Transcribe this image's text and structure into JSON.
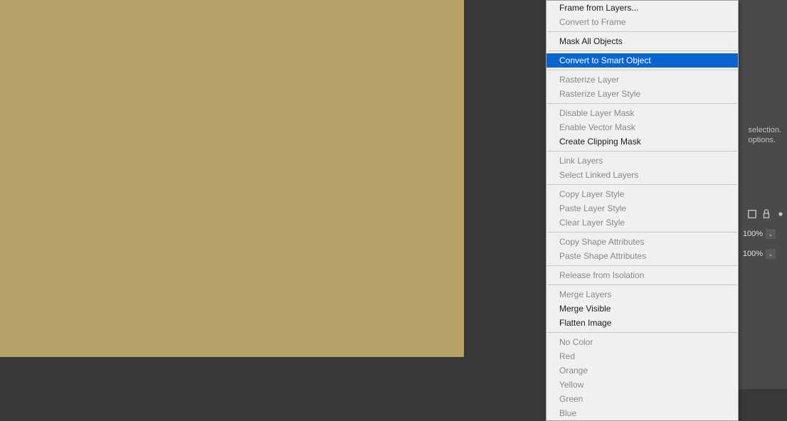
{
  "menu": {
    "items": [
      {
        "label": "Frame from Layers...",
        "disabled": false,
        "highlighted": false
      },
      {
        "label": "Convert to Frame",
        "disabled": true,
        "highlighted": false
      },
      {
        "separator": true
      },
      {
        "label": "Mask All Objects",
        "disabled": false,
        "highlighted": false
      },
      {
        "separator": true
      },
      {
        "label": "Convert to Smart Object",
        "disabled": false,
        "highlighted": true
      },
      {
        "separator": true
      },
      {
        "label": "Rasterize Layer",
        "disabled": true,
        "highlighted": false
      },
      {
        "label": "Rasterize Layer Style",
        "disabled": true,
        "highlighted": false
      },
      {
        "separator": true
      },
      {
        "label": "Disable Layer Mask",
        "disabled": true,
        "highlighted": false
      },
      {
        "label": "Enable Vector Mask",
        "disabled": true,
        "highlighted": false
      },
      {
        "label": "Create Clipping Mask",
        "disabled": false,
        "highlighted": false
      },
      {
        "separator": true
      },
      {
        "label": "Link Layers",
        "disabled": true,
        "highlighted": false
      },
      {
        "label": "Select Linked Layers",
        "disabled": true,
        "highlighted": false
      },
      {
        "separator": true
      },
      {
        "label": "Copy Layer Style",
        "disabled": true,
        "highlighted": false
      },
      {
        "label": "Paste Layer Style",
        "disabled": true,
        "highlighted": false
      },
      {
        "label": "Clear Layer Style",
        "disabled": true,
        "highlighted": false
      },
      {
        "separator": true
      },
      {
        "label": "Copy Shape Attributes",
        "disabled": true,
        "highlighted": false
      },
      {
        "label": "Paste Shape Attributes",
        "disabled": true,
        "highlighted": false
      },
      {
        "separator": true
      },
      {
        "label": "Release from Isolation",
        "disabled": true,
        "highlighted": false
      },
      {
        "separator": true
      },
      {
        "label": "Merge Layers",
        "disabled": true,
        "highlighted": false
      },
      {
        "label": "Merge Visible",
        "disabled": false,
        "highlighted": false
      },
      {
        "label": "Flatten Image",
        "disabled": false,
        "highlighted": false
      },
      {
        "separator": true
      },
      {
        "label": "No Color",
        "disabled": true,
        "highlighted": false
      },
      {
        "label": "Red",
        "disabled": true,
        "highlighted": false
      },
      {
        "label": "Orange",
        "disabled": true,
        "highlighted": false
      },
      {
        "label": "Yellow",
        "disabled": true,
        "highlighted": false
      },
      {
        "label": "Green",
        "disabled": true,
        "highlighted": false
      },
      {
        "label": "Blue",
        "disabled": true,
        "highlighted": false
      }
    ]
  },
  "panel": {
    "hint_line1": "selection.",
    "hint_line2": "options.",
    "opacity_value": "100%",
    "fill_value": "100%"
  }
}
